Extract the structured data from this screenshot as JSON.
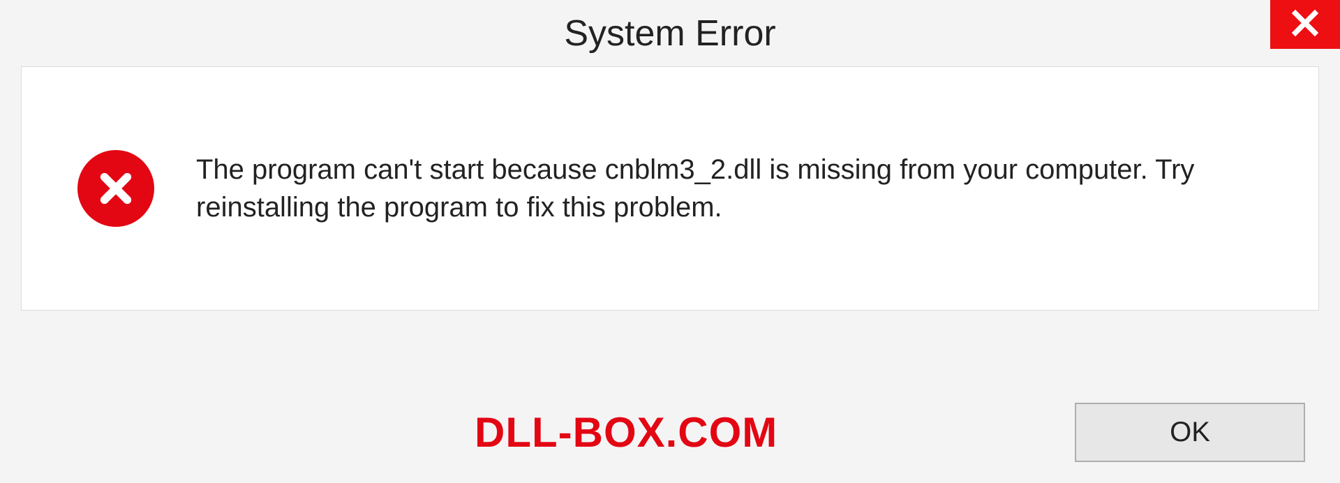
{
  "dialog": {
    "title": "System Error",
    "message": "The program can't start because cnblm3_2.dll is missing from your computer. Try reinstalling the program to fix this problem.",
    "ok_label": "OK"
  },
  "watermark": "DLL-BOX.COM"
}
